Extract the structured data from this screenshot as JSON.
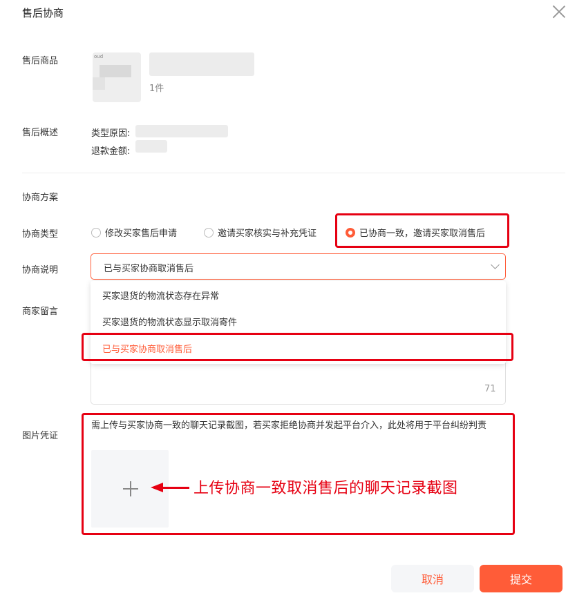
{
  "dialog": {
    "title": "售后协商"
  },
  "product": {
    "label": "售后商品",
    "thumb_text": "oud",
    "quantity": "1件"
  },
  "summary": {
    "label": "售后概述",
    "type_reason_label": "类型原因:",
    "refund_label": "退款金额:"
  },
  "plan": {
    "heading": "协商方案"
  },
  "negotiation_type": {
    "label": "协商类型",
    "options": [
      "修改买家售后申请",
      "邀请买家核实与补充凭证",
      "已协商一致，邀请买家取消售后"
    ],
    "selected_index": 2
  },
  "negotiation_desc": {
    "label": "协商说明",
    "value": "已与买家协商取消售后",
    "options": [
      "买家退货的物流状态存在异常",
      "买家退货的物流状态显示取消寄件",
      "已与买家协商取消售后"
    ]
  },
  "merchant_note": {
    "label": "商家留言",
    "counter": "71"
  },
  "evidence": {
    "label": "图片凭证",
    "hint": "需上传与买家协商一致的聊天记录截图，若买家拒绝协商并发起平台介入，此处将用于平台纠纷判责"
  },
  "annotation": {
    "text": "上传协商一致取消售后的聊天记录截图"
  },
  "footer": {
    "cancel": "取消",
    "submit": "提交"
  },
  "colors": {
    "accent": "#ff5c38",
    "annotation": "#e60012"
  }
}
